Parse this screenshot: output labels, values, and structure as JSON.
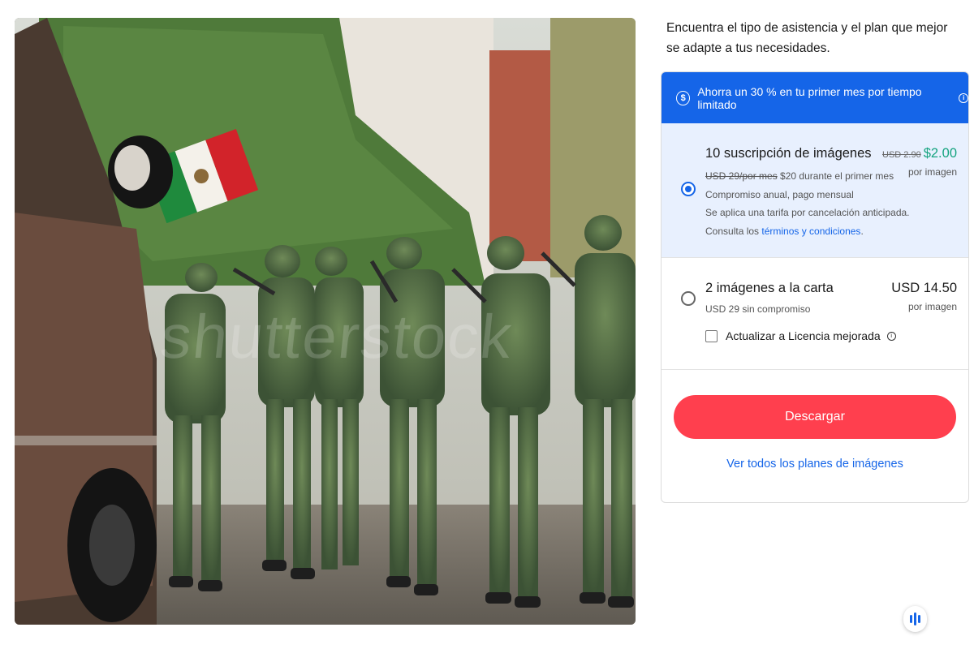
{
  "photo": {
    "watermark": "shutterstock",
    "alt_subject": "soldiers marching with Mexican flag"
  },
  "intro": {
    "text": "Encuentra el tipo de asistencia y el plan que mejor se adapte a tus necesidades."
  },
  "promo": {
    "text": "Ahorra un 30 % en tu primer mes por tiempo limitado",
    "icon": "dollar-circle-icon",
    "info_icon": "info-icon"
  },
  "plans": [
    {
      "title": "10 suscripción de imágenes",
      "old_price": "USD 2.90",
      "price": "$2.00",
      "per_unit": "por imagen",
      "old_monthly": "USD 29/por mes",
      "first_month": " $20 durante el primer mes",
      "commitment": "Compromiso anual, pago mensual",
      "fee_note": "Se aplica una tarifa por cancelación anticipada.",
      "terms_prefix": "Consulta los ",
      "terms_link": "términos y condiciones",
      "terms_suffix": ".",
      "selected": true
    },
    {
      "title": "2 imágenes a la carta",
      "price": "USD 14.50",
      "per_unit": "por imagen",
      "subtitle": "USD 29 sin compromiso",
      "checkbox_label": "Actualizar a Licencia mejorada",
      "selected": false
    }
  ],
  "actions": {
    "download_label": "Descargar",
    "all_plans_link": "Ver todos los planes de imágenes"
  },
  "colors": {
    "accent_blue": "#1565e8",
    "download_red": "#ff3f4e",
    "discount_green": "#14a37f",
    "selected_bg": "#e8f0fe"
  }
}
